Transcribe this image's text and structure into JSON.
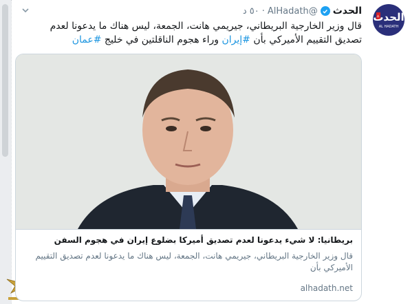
{
  "tweet": {
    "display_name": "الحدث",
    "handle": "@AlHadath",
    "separator": "·",
    "timestamp": "٥٠ د",
    "text_main": "قال وزير الخارجية البريطاني، جيريمي هانت، الجمعة، ليس هناك ما يدعونا لعدم تصديق التقييم الأميركي بأن ",
    "hashtag_iran": "#إيران",
    "text_mid": " وراء هجوم الناقلتين في خليج ",
    "hashtag_oman": "#عمان"
  },
  "avatar": {
    "logo_text": "الحدث",
    "logo_sub": "AL HADATH"
  },
  "card": {
    "title": "بريطانيا: لا شيء يدعونا لعدم تصديق أميركا بضلوع إيران في هجوم السفن",
    "description": "قال وزير الخارجية البريطاني، جيريمي هانت، الجمعة، ليس هناك ما يدعونا لعدم تصديق التقييم الأميركي بأن",
    "domain": "alhadath.net"
  },
  "colors": {
    "link": "#1b95e0",
    "verified": "#1da1f2",
    "avatar_bg": "#2a2f7a",
    "brand_red": "#d62027"
  },
  "icons": {
    "verified": "verified-badge-icon",
    "caret": "chevron-down-icon"
  }
}
